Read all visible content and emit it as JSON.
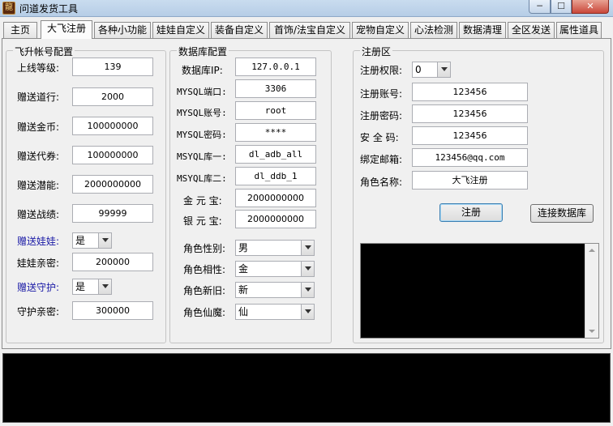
{
  "window": {
    "title": "问道发货工具",
    "app_icon": "dragon-icon",
    "min_glyph": "─",
    "max_glyph": "☐",
    "close_glyph": "✕"
  },
  "tabs": [
    "主页",
    "大飞注册",
    "各种小功能",
    "娃娃自定义",
    "装备自定义",
    "首饰/法宝自定义",
    "宠物自定义",
    "心法检测",
    "数据清理",
    "全区发送",
    "属性道具"
  ],
  "active_tab": "大飞注册",
  "account_config": {
    "title": "飞升帐号配置",
    "level_label": "上线等级:",
    "level": "139",
    "daoxing_label": "赠送道行:",
    "daoxing": "2000",
    "gold_label": "赠送金币:",
    "gold": "100000000",
    "voucher_label": "赠送代券:",
    "voucher": "100000000",
    "potential_label": "赠送潜能:",
    "potential": "2000000000",
    "merit_label": "赠送战绩:",
    "merit": "99999",
    "doll_label": "赠送娃娃:",
    "doll": "是",
    "doll_intimacy_label": "娃娃亲密:",
    "doll_intimacy": "200000",
    "guard_label": "赠送守护:",
    "guard": "是",
    "guard_intimacy_label": "守护亲密:",
    "guard_intimacy": "300000"
  },
  "db_config": {
    "title": "数据库配置",
    "ip_label": "数据库IP:",
    "ip": "127.0.0.1",
    "port_label": "MYSQL端口:",
    "port": "3306",
    "user_label": "MYSQL账号:",
    "user": "root",
    "password_label": "MYSQL密码:",
    "password": "****",
    "db1_label": "MSYQL库一:",
    "db1": "dl_adb_all",
    "db2_label": "MSYQL库二:",
    "db2": "dl_ddb_1",
    "gold_ingot_label": "金 元 宝:",
    "gold_ingot": "2000000000",
    "silver_ingot_label": "银 元 宝:",
    "silver_ingot": "2000000000",
    "gender_label": "角色性别:",
    "gender": "男",
    "element_label": "角色相性:",
    "element": "金",
    "newold_label": "角色新旧:",
    "newold": "新",
    "immortal_label": "角色仙魔:",
    "immortal": "仙"
  },
  "register": {
    "title": "注册区",
    "perm_label": "注册权限:",
    "perm": "0",
    "account_label": "注册账号:",
    "account": "123456",
    "password_label": "注册密码:",
    "password": "123456",
    "security_label": "安 全 码:",
    "security": "123456",
    "email_label": "绑定邮箱:",
    "email": "123456@qq.com",
    "role_label": "角色名称:",
    "role": "大飞注册",
    "register_button": "注册",
    "connect_button": "连接数据库"
  }
}
